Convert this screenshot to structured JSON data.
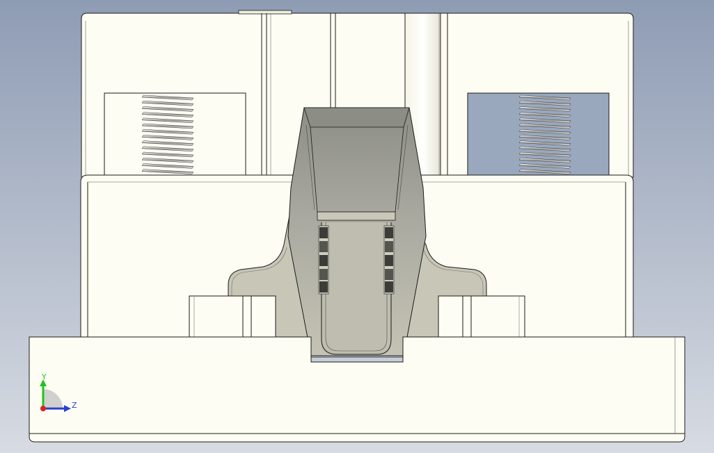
{
  "viewport": {
    "background_top": "#8e9cb4",
    "background_bottom": "#d7dbe2"
  },
  "part": {
    "body_color": "#fdfdf3",
    "edge_color": "#1a1a1a",
    "clip_color": "#b9b8a9",
    "clip_dark": "#8f8f86",
    "thread_color": "#b3b3b3"
  },
  "triad": {
    "y_label": "Y",
    "z_label": "Z",
    "y_color": "#1fc41f",
    "z_color": "#2b3fd0",
    "x_color": "#d92020"
  }
}
